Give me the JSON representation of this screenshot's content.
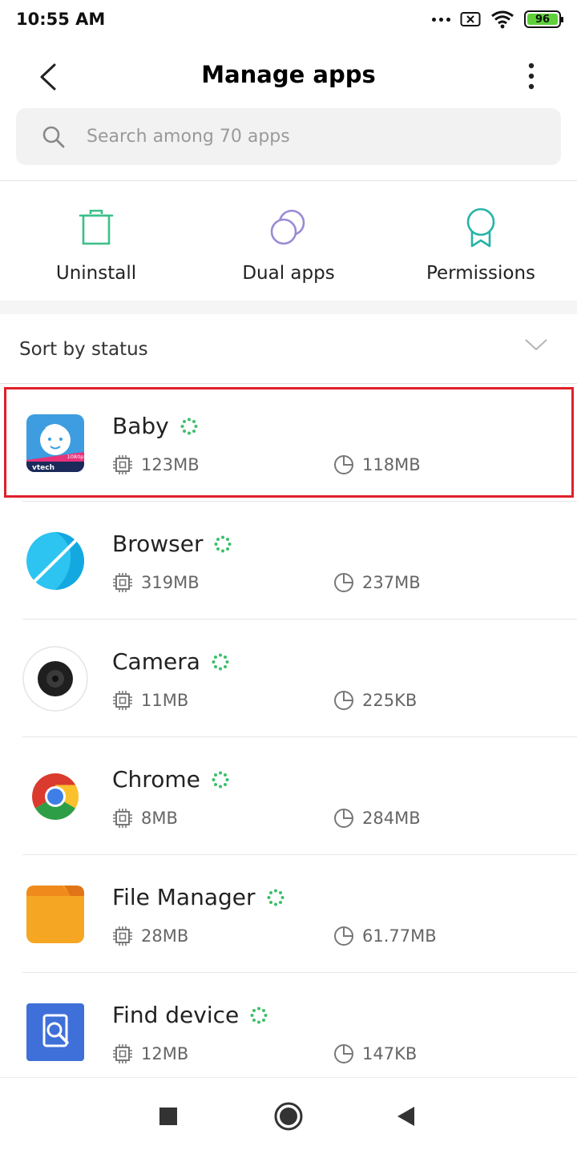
{
  "status_bar": {
    "time": "10:55 AM",
    "battery_level": "96",
    "icons": [
      "more-dots-icon",
      "sim-no-signal-icon",
      "wifi-icon",
      "battery-icon"
    ]
  },
  "header": {
    "title": "Manage apps"
  },
  "search": {
    "placeholder": "Search among 70 apps",
    "value": ""
  },
  "actions": [
    {
      "label": "Uninstall",
      "icon": "trash-icon",
      "color": "#3dbf8a"
    },
    {
      "label": "Dual apps",
      "icon": "dual-circles-icon",
      "color": "#9b8ad6"
    },
    {
      "label": "Permissions",
      "icon": "ribbon-badge-icon",
      "color": "#26b3a8"
    }
  ],
  "sort": {
    "label": "Sort by status"
  },
  "apps": [
    {
      "name": "Baby",
      "storage": "123MB",
      "data": "118MB",
      "icon": "baby-vtech-icon",
      "icon_badge": "1080p",
      "icon_text": "vtech"
    },
    {
      "name": "Browser",
      "storage": "319MB",
      "data": "237MB",
      "icon": "browser-planet-icon"
    },
    {
      "name": "Camera",
      "storage": "11MB",
      "data": "225KB",
      "icon": "camera-lens-icon"
    },
    {
      "name": "Chrome",
      "storage": "8MB",
      "data": "284MB",
      "icon": "chrome-icon"
    },
    {
      "name": "File Manager",
      "storage": "28MB",
      "data": "61.77MB",
      "icon": "folder-icon"
    },
    {
      "name": "Find device",
      "storage": "12MB",
      "data": "147KB",
      "icon": "find-device-icon"
    }
  ],
  "colors": {
    "status_running": "#3dbf6a",
    "highlight": "#e0202a",
    "battery": "#5fd03a"
  },
  "nav_bar": {
    "icons": [
      "recents-square-icon",
      "home-circle-icon",
      "back-triangle-icon"
    ]
  }
}
